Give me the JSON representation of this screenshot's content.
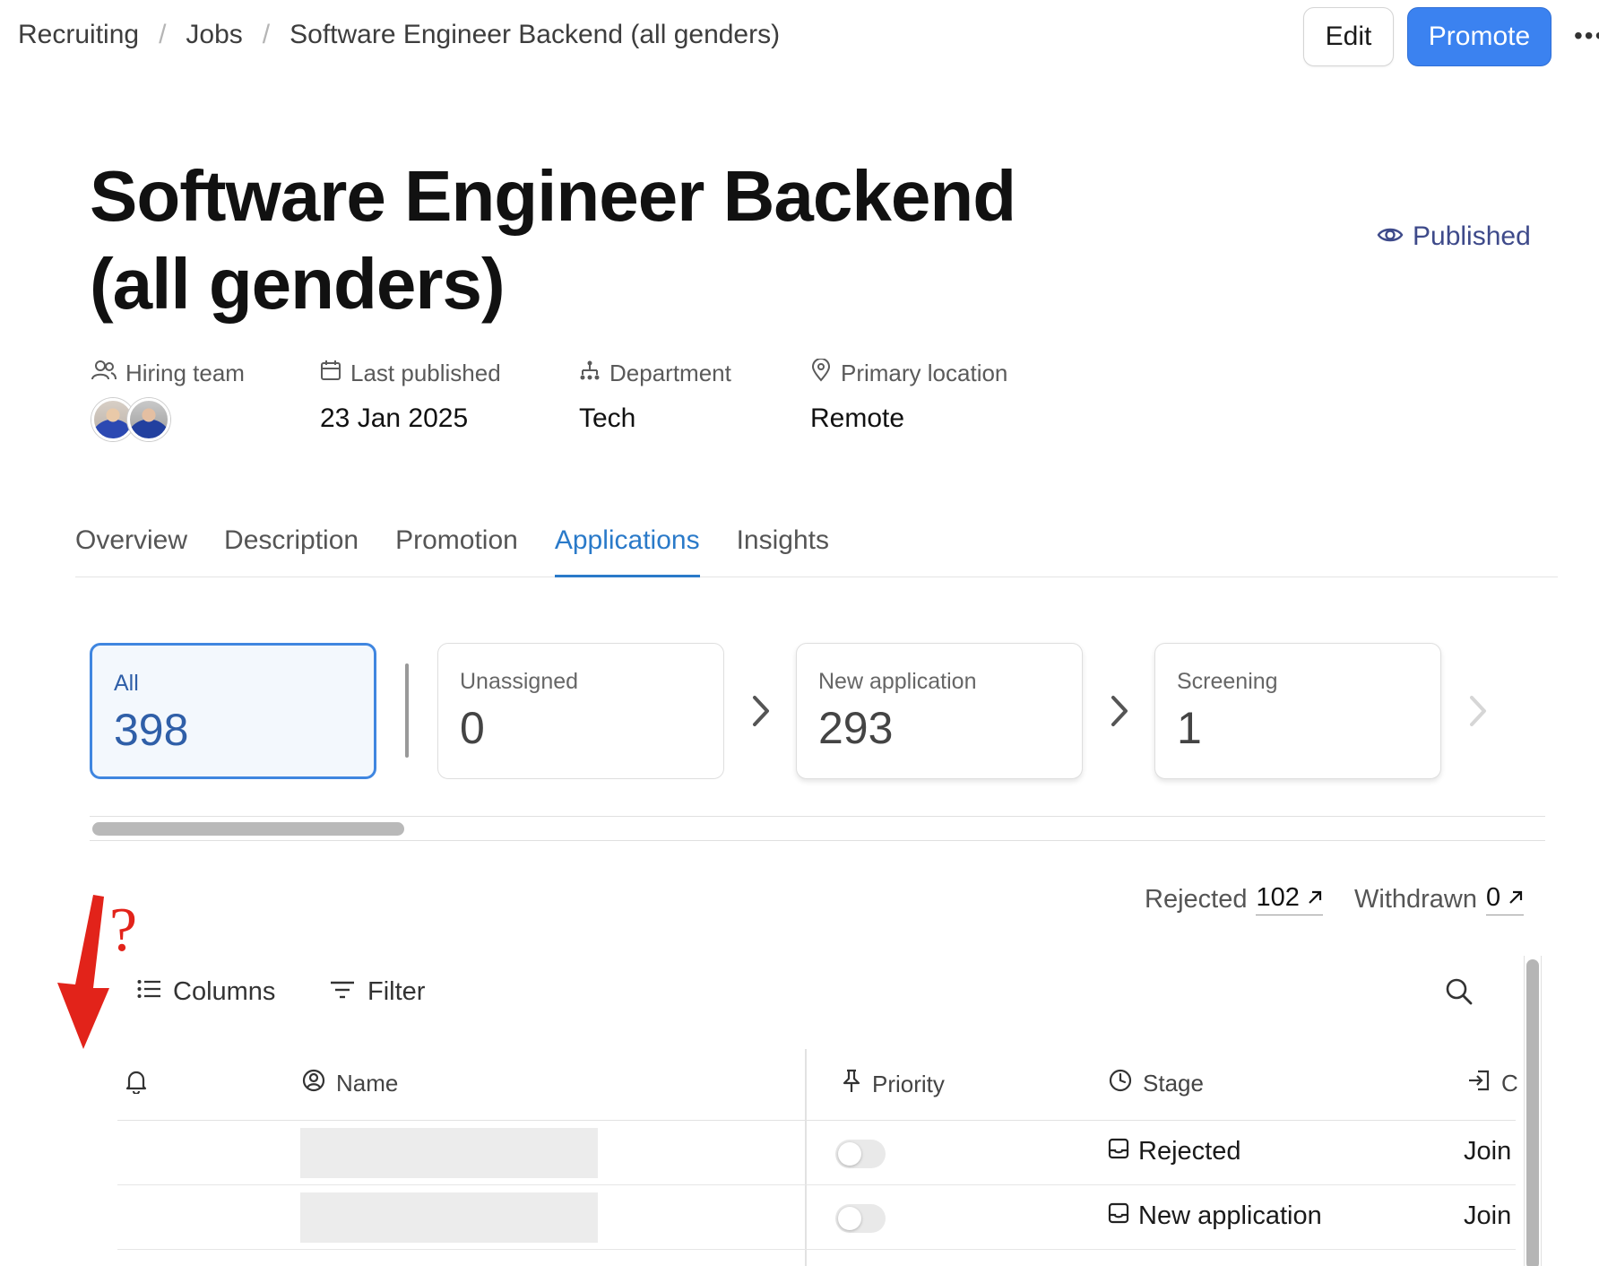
{
  "breadcrumb": [
    "Recruiting",
    "Jobs",
    "Software Engineer Backend (all genders)"
  ],
  "breadcrumb_separator": "/",
  "header": {
    "edit_label": "Edit",
    "promote_label": "Promote",
    "more_label": "•••"
  },
  "job": {
    "title": "Software Engineer Backend (all genders)",
    "status": "Published"
  },
  "meta": {
    "hiring_team_label": "Hiring team",
    "last_published_label": "Last published",
    "last_published_value": "23 Jan 2025",
    "department_label": "Department",
    "department_value": "Tech",
    "location_label": "Primary location",
    "location_value": "Remote"
  },
  "tabs": [
    {
      "label": "Overview"
    },
    {
      "label": "Description"
    },
    {
      "label": "Promotion"
    },
    {
      "label": "Applications",
      "active": true
    },
    {
      "label": "Insights"
    }
  ],
  "stages": [
    {
      "label": "All",
      "count": "398"
    },
    {
      "label": "Unassigned",
      "count": "0"
    },
    {
      "label": "New application",
      "count": "293"
    },
    {
      "label": "Screening",
      "count": "1"
    }
  ],
  "counters": {
    "rejected_label": "Rejected",
    "rejected_count": "102",
    "withdrawn_label": "Withdrawn",
    "withdrawn_count": "0"
  },
  "toolbar": {
    "columns_label": "Columns",
    "filter_label": "Filter"
  },
  "annotation": {
    "mark": "?"
  },
  "table": {
    "headers": {
      "name": "Name",
      "priority": "Priority",
      "stage": "Stage",
      "source": "C"
    },
    "rows": [
      {
        "stage": "Rejected",
        "source": "Join"
      },
      {
        "stage": "New application",
        "source": "Join"
      }
    ]
  },
  "colors": {
    "accent": "#3b82f0",
    "active_tab": "#2a7ac9",
    "status": "#3e4a8a",
    "annotation": "#e2231a"
  },
  "icons": {
    "hiring_team": "users-icon",
    "last_published": "calendar-icon",
    "department": "org-chart-icon",
    "location": "map-pin-icon",
    "status": "eye-icon",
    "columns": "list-icon",
    "filter": "filter-icon",
    "search": "search-icon",
    "notifications": "bell-icon",
    "name": "user-circle-icon",
    "priority": "pin-icon",
    "stage": "clock-icon",
    "source": "sign-in-icon",
    "stage_row": "inbox-icon"
  }
}
